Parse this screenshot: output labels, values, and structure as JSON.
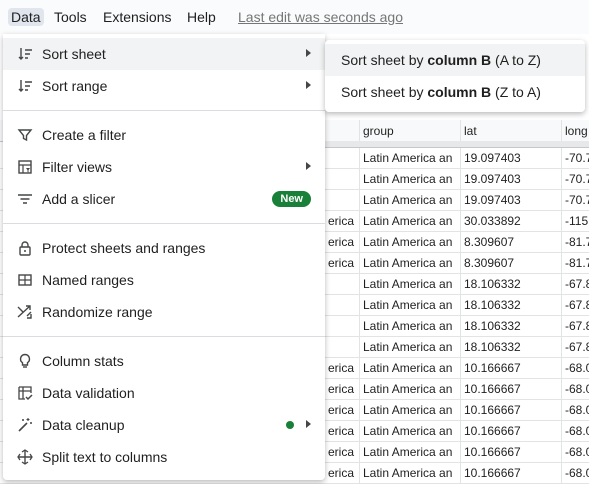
{
  "menubar": {
    "items": [
      "Data",
      "Tools",
      "Extensions",
      "Help"
    ],
    "last_edit": "Last edit was seconds ago"
  },
  "sheet": {
    "headers": [
      "group",
      "lat",
      "long"
    ],
    "rows": [
      {
        "a": "",
        "group": "Latin America an",
        "lat": "19.097403",
        "long": "-70.7"
      },
      {
        "a": "",
        "group": "Latin America an",
        "lat": "19.097403",
        "long": "-70.7"
      },
      {
        "a": "",
        "group": "Latin America an",
        "lat": "19.097403",
        "long": "-70.7"
      },
      {
        "a": "erica",
        "group": "Latin America an",
        "lat": "30.033892",
        "long": "-115"
      },
      {
        "a": "erica",
        "group": "Latin America an",
        "lat": "8.309607",
        "long": "-81.7"
      },
      {
        "a": "erica",
        "group": "Latin America an",
        "lat": "8.309607",
        "long": "-81.7"
      },
      {
        "a": "",
        "group": "Latin America an",
        "lat": "18.106332",
        "long": "-67.8"
      },
      {
        "a": "",
        "group": "Latin America an",
        "lat": "18.106332",
        "long": "-67.8"
      },
      {
        "a": "",
        "group": "Latin America an",
        "lat": "18.106332",
        "long": "-67.8"
      },
      {
        "a": "",
        "group": "Latin America an",
        "lat": "18.106332",
        "long": "-67.8"
      },
      {
        "a": "erica",
        "group": "Latin America an",
        "lat": "10.166667",
        "long": "-68.0"
      },
      {
        "a": "erica",
        "group": "Latin America an",
        "lat": "10.166667",
        "long": "-68.0"
      },
      {
        "a": "erica",
        "group": "Latin America an",
        "lat": "10.166667",
        "long": "-68.0"
      },
      {
        "a": "erica",
        "group": "Latin America an",
        "lat": "10.166667",
        "long": "-68.0"
      },
      {
        "a": "erica",
        "group": "Latin America an",
        "lat": "10.166667",
        "long": "-68.0"
      },
      {
        "a": "erica",
        "group": "Latin America an",
        "lat": "10.166667",
        "long": "-68.0"
      }
    ]
  },
  "menu": {
    "sort_sheet": "Sort sheet",
    "sort_range": "Sort range",
    "create_filter": "Create a filter",
    "filter_views": "Filter views",
    "add_slicer": "Add a slicer",
    "new_badge": "New",
    "protect": "Protect sheets and ranges",
    "named_ranges": "Named ranges",
    "randomize": "Randomize range",
    "column_stats": "Column stats",
    "data_validation": "Data validation",
    "data_cleanup": "Data cleanup",
    "split_text": "Split text to columns"
  },
  "submenu": {
    "asc_prefix": "Sort sheet by ",
    "asc_bold": "column B",
    "asc_suffix": " (A to Z)",
    "desc_prefix": "Sort sheet by ",
    "desc_bold": "column B",
    "desc_suffix": " (Z to A)"
  },
  "colors": {
    "accent_green": "#188038",
    "hover_bg": "#f1f3f4",
    "menubar_bg": "#f9fbfd"
  }
}
